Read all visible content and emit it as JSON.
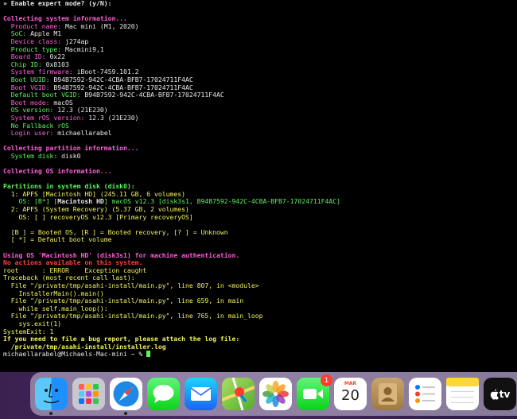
{
  "terminal": {
    "lines": [
      [
        {
          "t": "» Enable expert mode? (y/N):",
          "c": "white bold"
        }
      ],
      [
        {
          "t": "",
          "c": "white"
        }
      ],
      [
        {
          "t": "Collecting system information...",
          "c": "pink bold"
        }
      ],
      [
        {
          "t": "  Product name: ",
          "c": "pink"
        },
        {
          "t": "Mac mini (M1, 2020)",
          "c": "white"
        }
      ],
      [
        {
          "t": "  SoC: ",
          "c": "green"
        },
        {
          "t": "Apple M1",
          "c": "white"
        }
      ],
      [
        {
          "t": "  Device class: ",
          "c": "pink"
        },
        {
          "t": "j274ap",
          "c": "white"
        }
      ],
      [
        {
          "t": "  Product type: ",
          "c": "green"
        },
        {
          "t": "Macmini9,1",
          "c": "white"
        }
      ],
      [
        {
          "t": "  Board ID: ",
          "c": "pink"
        },
        {
          "t": "0x22",
          "c": "white"
        }
      ],
      [
        {
          "t": "  Chip ID: ",
          "c": "green"
        },
        {
          "t": "0x8103",
          "c": "white"
        }
      ],
      [
        {
          "t": "  System firmware: ",
          "c": "pink"
        },
        {
          "t": "iBoot-7459.101.2",
          "c": "white"
        }
      ],
      [
        {
          "t": "  Boot UUID: ",
          "c": "green"
        },
        {
          "t": "B94B7592-942C-4CBA-BFB7-17024711F4AC",
          "c": "white"
        }
      ],
      [
        {
          "t": "  Boot VGID: ",
          "c": "pink"
        },
        {
          "t": "B94B7592-942C-4CBA-BFB7-17024711F4AC",
          "c": "white"
        }
      ],
      [
        {
          "t": "  Default boot VGID: ",
          "c": "green"
        },
        {
          "t": "B94B7592-942C-4CBA-BFB7-17024711F4AC",
          "c": "white"
        }
      ],
      [
        {
          "t": "  Boot mode: ",
          "c": "pink"
        },
        {
          "t": "macOS",
          "c": "white"
        }
      ],
      [
        {
          "t": "  OS version: ",
          "c": "green"
        },
        {
          "t": "12.3 (21E230)",
          "c": "white"
        }
      ],
      [
        {
          "t": "  System rOS version: ",
          "c": "pink"
        },
        {
          "t": "12.3 (21E230)",
          "c": "white"
        }
      ],
      [
        {
          "t": "  No Fallback rOS",
          "c": "green"
        }
      ],
      [
        {
          "t": "  Login user: ",
          "c": "pink"
        },
        {
          "t": "michaellarabel",
          "c": "white"
        }
      ],
      [
        {
          "t": "",
          "c": "white"
        }
      ],
      [
        {
          "t": "Collecting partition information...",
          "c": "pink bold"
        }
      ],
      [
        {
          "t": "  System disk: ",
          "c": "green"
        },
        {
          "t": "disk0",
          "c": "white"
        }
      ],
      [
        {
          "t": "",
          "c": "white"
        }
      ],
      [
        {
          "t": "Collecting OS information...",
          "c": "pink bold"
        }
      ],
      [
        {
          "t": "",
          "c": "white"
        }
      ],
      [
        {
          "t": "Partitions in system disk (disk0):",
          "c": "green bold"
        }
      ],
      [
        {
          "t": "  1: APFS [Macintosh HD] (245.11 GB, 6 volumes)",
          "c": "yellow"
        }
      ],
      [
        {
          "t": "    OS: [B*] [",
          "c": "green"
        },
        {
          "t": "Macintosh HD",
          "c": "white bold"
        },
        {
          "t": "] macOS v12.3 [disk3s1, B94B7592-942C-4CBA-BFB7-17024711F4AC]",
          "c": "green"
        }
      ],
      [
        {
          "t": "  2: APFS (System Recovery) (5.37 GB, 2 volumes)",
          "c": "yellow"
        }
      ],
      [
        {
          "t": "    OS: [ ] recoveryOS v12.3 [Primary recoveryOS]",
          "c": "yellow"
        }
      ],
      [
        {
          "t": "",
          "c": "white"
        }
      ],
      [
        {
          "t": "  [B ] = Booted OS, [R ] = Booted recovery, [? ] = Unknown",
          "c": "yellow"
        }
      ],
      [
        {
          "t": "  [ *] = Default boot volume",
          "c": "yellow"
        }
      ],
      [
        {
          "t": "",
          "c": "white"
        }
      ],
      [
        {
          "t": "Using OS 'Macintosh HD' (disk3s1) for machine authentication.",
          "c": "pink bold"
        }
      ],
      [
        {
          "t": "No actions available on this system.",
          "c": "red bold"
        }
      ],
      [
        {
          "t": "root      : ERROR    Exception caught",
          "c": "yellow"
        }
      ],
      [
        {
          "t": "Traceback (most recent call last):",
          "c": "yellow"
        }
      ],
      [
        {
          "t": "  File \"/private/tmp/asahi-install/main.py\", line 807, in <module>",
          "c": "yellow"
        }
      ],
      [
        {
          "t": "    InstallerMain().main()",
          "c": "yellow"
        }
      ],
      [
        {
          "t": "  File \"/private/tmp/asahi-install/main.py\", line 659, in main",
          "c": "yellow"
        }
      ],
      [
        {
          "t": "    while self.main_loop():",
          "c": "yellow"
        }
      ],
      [
        {
          "t": "  File \"/private/tmp/asahi-install/main.py\", line 765, in main_loop",
          "c": "yellow"
        }
      ],
      [
        {
          "t": "    sys.exit(1)",
          "c": "yellow"
        }
      ],
      [
        {
          "t": "SystemExit: 1",
          "c": "yellow"
        }
      ],
      [
        {
          "t": "If you need to file a bug report, please attach the log file:",
          "c": "yellow bold"
        }
      ],
      [
        {
          "t": "  /private/tmp/asahi-install/installer.log",
          "c": "yellow bold"
        }
      ],
      [
        {
          "t": "michaellarabel@Michaels-Mac-mini ~ % ",
          "c": "white"
        }
      ]
    ]
  },
  "dock": {
    "apps": [
      {
        "name": "finder",
        "icon": "finder-icon",
        "running": true
      },
      {
        "name": "launchpad",
        "icon": "launchpad-icon",
        "running": false
      },
      {
        "name": "safari",
        "icon": "safari-icon",
        "running": true
      },
      {
        "name": "messages",
        "icon": "messages-icon",
        "running": false
      },
      {
        "name": "mail",
        "icon": "mail-icon",
        "running": false
      },
      {
        "name": "maps",
        "icon": "maps-icon",
        "running": false
      },
      {
        "name": "photos",
        "icon": "photos-icon",
        "running": false
      },
      {
        "name": "facetime",
        "icon": "facetime-icon",
        "running": false,
        "badge": "1"
      },
      {
        "name": "calendar",
        "icon": "calendar-icon",
        "running": false,
        "month": "MAR",
        "day": "20"
      },
      {
        "name": "contacts",
        "icon": "contacts-icon",
        "running": false
      },
      {
        "name": "reminders",
        "icon": "reminders-icon",
        "running": false
      },
      {
        "name": "notes",
        "icon": "notes-icon",
        "running": false
      },
      {
        "name": "apple-tv",
        "icon": "apple-tv-icon",
        "running": false,
        "label": "tv"
      }
    ]
  }
}
